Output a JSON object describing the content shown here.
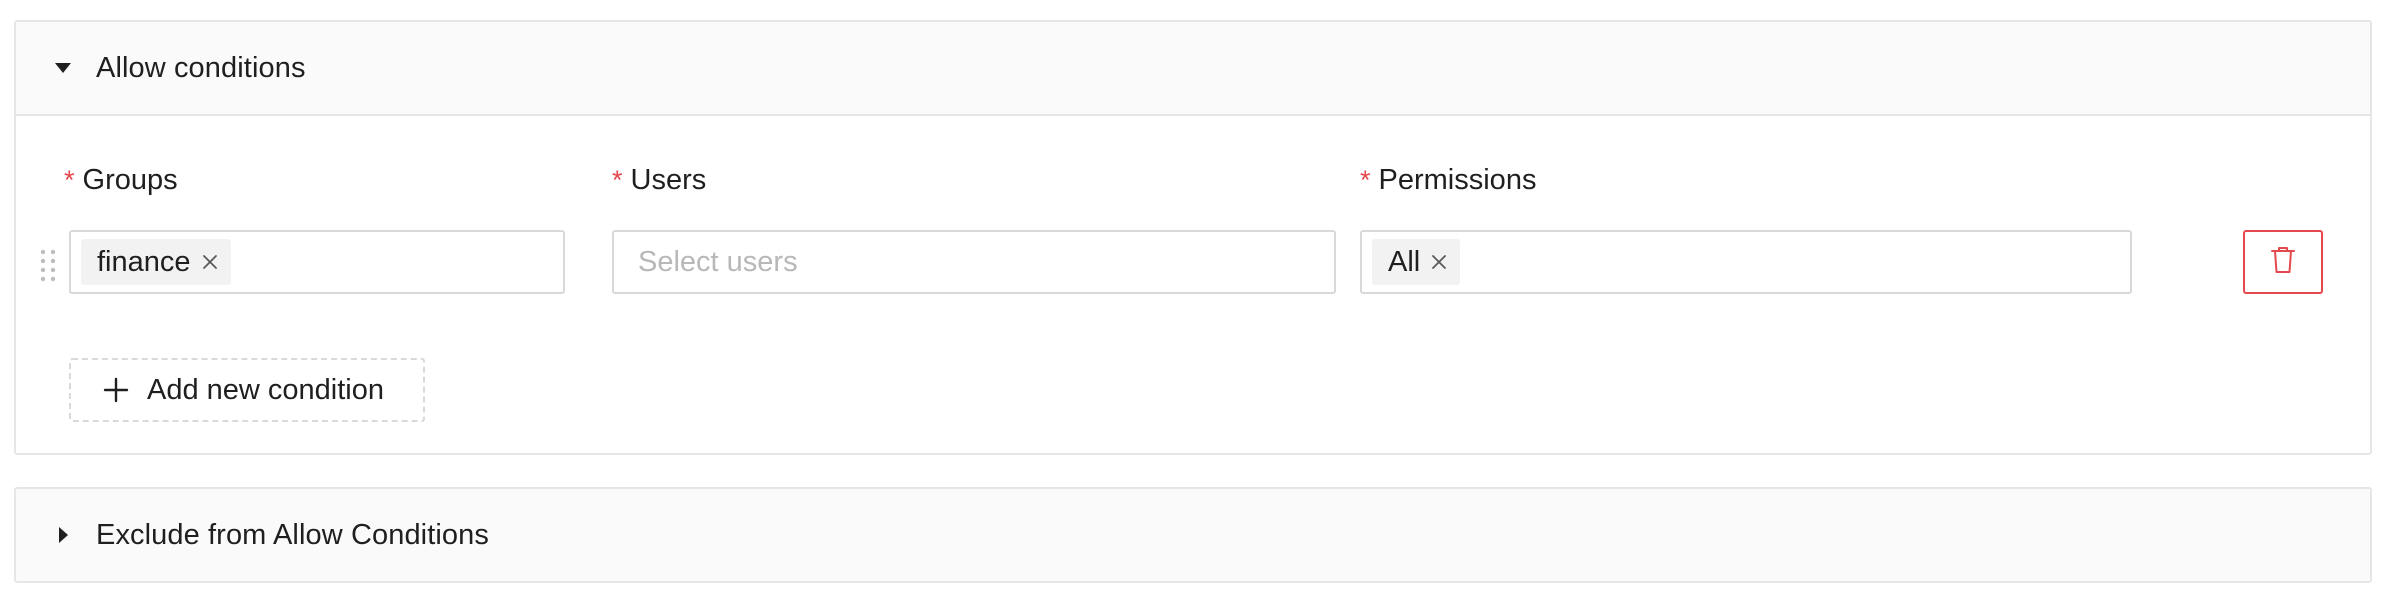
{
  "allow_panel": {
    "title": "Allow conditions",
    "expanded": true,
    "caret_icon": "caret-down-icon",
    "fields": {
      "groups": {
        "label": "Groups",
        "required_marker": "*",
        "selected": [
          "finance"
        ]
      },
      "users": {
        "label": "Users",
        "required_marker": "*",
        "placeholder": "Select users",
        "selected": []
      },
      "permissions": {
        "label": "Permissions",
        "required_marker": "*",
        "selected": [
          "All"
        ]
      }
    },
    "add_condition_label": "Add new condition"
  },
  "exclude_panel": {
    "title": "Exclude from Allow Conditions",
    "expanded": false,
    "caret_icon": "caret-right-icon"
  },
  "colors": {
    "required": "#e5484d",
    "danger": "#e5484d",
    "border": "#d9d9d9",
    "header_bg": "#fafafa",
    "tag_bg": "#f2f2f2",
    "placeholder": "#b8b8b8"
  }
}
